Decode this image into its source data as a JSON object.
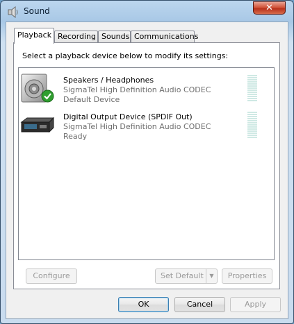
{
  "window": {
    "title": "Sound",
    "close_glyph": "✕",
    "app_icon": "speaker-icon"
  },
  "tabs": [
    {
      "label": "Playback",
      "active": true
    },
    {
      "label": "Recording",
      "active": false
    },
    {
      "label": "Sounds",
      "active": false
    },
    {
      "label": "Communications",
      "active": false
    }
  ],
  "playback": {
    "instructions": "Select a playback device below to modify its settings:",
    "devices": [
      {
        "name": "Speakers / Headphones",
        "driver": "SigmaTel High Definition Audio CODEC",
        "status": "Default Device",
        "icon": "speaker-icon",
        "default_badge": "check-badge-icon",
        "level": 0
      },
      {
        "name": "Digital Output Device (SPDIF Out)",
        "driver": "SigmaTel High Definition Audio CODEC",
        "status": "Ready",
        "icon": "digital-output-icon",
        "level": 0
      }
    ],
    "configure_label": "Configure",
    "set_default_label": "Set Default",
    "set_default_arrow": "▼",
    "properties_label": "Properties"
  },
  "dialog_buttons": {
    "ok": "OK",
    "cancel": "Cancel",
    "apply": "Apply"
  },
  "colors": {
    "level_meter": "#cfe9e4",
    "default_check": "#2f9e2f",
    "close_button": "#c8442c"
  }
}
